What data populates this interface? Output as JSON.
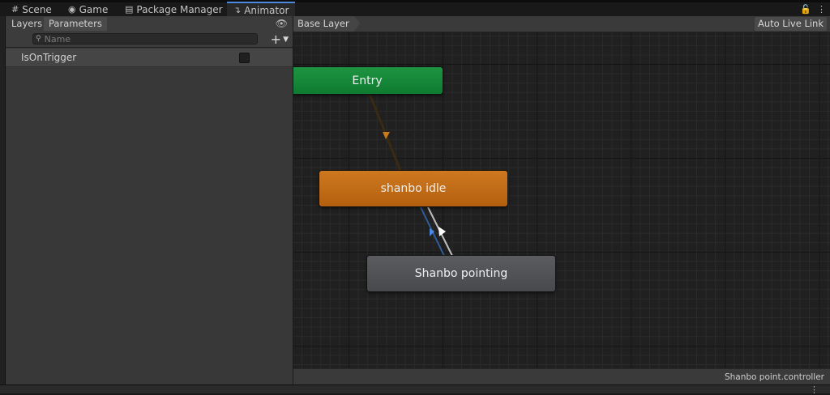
{
  "window_tabs": [
    {
      "label": "Scene",
      "icon": "grid-icon"
    },
    {
      "label": "Game",
      "icon": "gamepad-icon"
    },
    {
      "label": "Package Manager",
      "icon": "package-icon"
    },
    {
      "label": "Animator",
      "icon": "animator-icon"
    }
  ],
  "parameters_panel": {
    "tabs": [
      "Layers",
      "Parameters"
    ],
    "selected_tab": "Parameters",
    "search_placeholder": "Name",
    "add_label": "+",
    "parameters": [
      {
        "name": "IsOnTrigger",
        "type": "trigger",
        "value": false
      }
    ]
  },
  "graph": {
    "breadcrumb": "Base Layer",
    "auto_live_link": "Auto Live Link",
    "nodes": {
      "entry": "Entry",
      "idle": "shanbo idle",
      "pointing": "Shanbo pointing"
    },
    "colors": {
      "entry": "#1a8c3c",
      "default_state": "#c46c16",
      "state": "#515255",
      "entry_transition": "#b5651d",
      "selected_transition": "#4a8ae0"
    },
    "footer_file": "Shanbo point.controller"
  }
}
